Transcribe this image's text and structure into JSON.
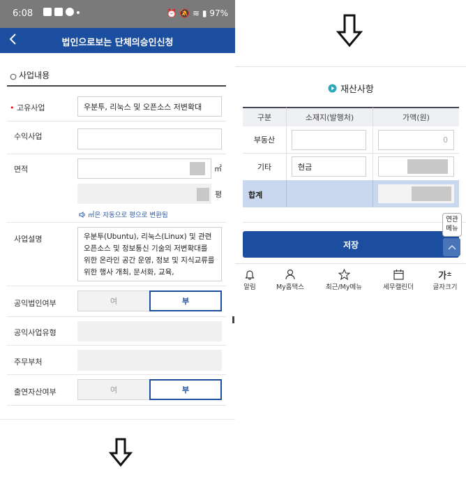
{
  "status_bar": {
    "time": "6:08",
    "battery": "97%"
  },
  "header": {
    "title": "법인으로보는 단체의승인신청"
  },
  "business": {
    "section_title": "사업내용",
    "unique_business_label": "고유사업",
    "unique_business_value": "우분투, 리눅스 및 오픈소스 저변확대",
    "profit_business_label": "수익사업",
    "area_label": "면적",
    "unit_m2": "㎡",
    "unit_pyeong": "평",
    "convert_hint": "㎡은 자동으로 평으로 변환됨",
    "description_label": "사업설명",
    "description_value": "우분투(Ubuntu), 리눅스(Linux) 및 관련 오픈소스 및 정보통신 기술의 저변확대를 위한 온라인 공간 운영, 정보 및 지식교류를 위한 행사 개최, 문서화, 교육,",
    "public_corp_label": "공익법인여부",
    "yes": "여",
    "no": "부",
    "public_type_label": "공익사업유형",
    "ministry_label": "주무부처",
    "contribution_label": "출연자산여부"
  },
  "assets": {
    "title": "재산사항",
    "columns": [
      "구분",
      "소재지(발행처)",
      "가액(원)"
    ],
    "rows": [
      {
        "category": "부동산",
        "location": "",
        "amount": "0"
      },
      {
        "category": "기타",
        "location": "현금",
        "amount": ""
      }
    ],
    "total_label": "합계",
    "save_label": "저장",
    "related_menu": "연관\n메뉴"
  },
  "bottom_nav": [
    {
      "label": "알림",
      "icon": "bell-icon"
    },
    {
      "label": "My홈택스",
      "icon": "person-icon"
    },
    {
      "label": "최근/My메뉴",
      "icon": "star-icon"
    },
    {
      "label": "세무캘린더",
      "icon": "calendar-icon"
    },
    {
      "label": "글자크기",
      "icon": "font-size-icon"
    }
  ]
}
